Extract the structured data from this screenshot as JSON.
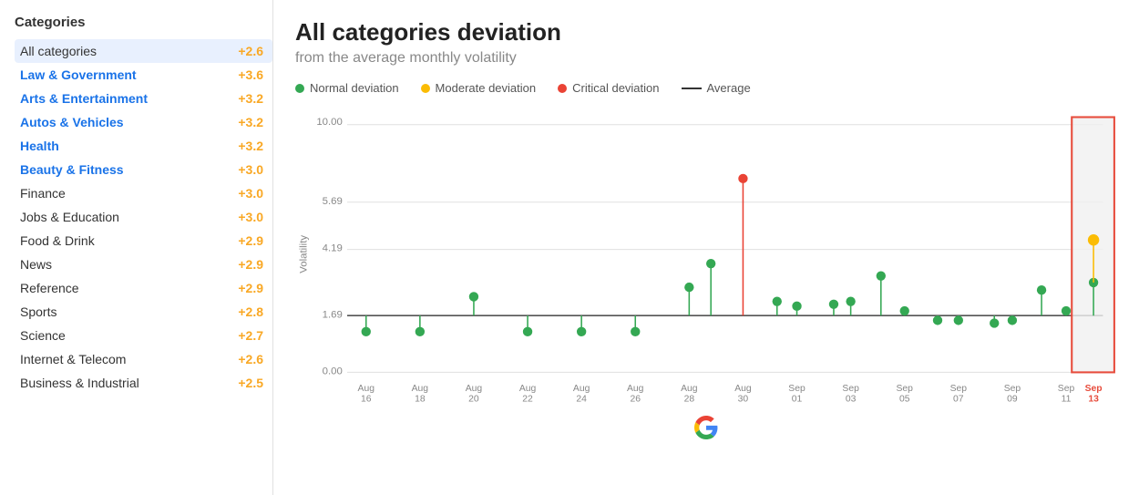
{
  "sidebar": {
    "title": "Categories",
    "items": [
      {
        "id": "all-categories",
        "name": "All categories",
        "value": "+2.6",
        "bold": false,
        "selected": true
      },
      {
        "id": "law-government",
        "name": "Law & Government",
        "value": "+3.6",
        "bold": true
      },
      {
        "id": "arts-entertainment",
        "name": "Arts & Entertainment",
        "value": "+3.2",
        "bold": true
      },
      {
        "id": "autos-vehicles",
        "name": "Autos & Vehicles",
        "value": "+3.2",
        "bold": true
      },
      {
        "id": "health",
        "name": "Health",
        "value": "+3.2",
        "bold": true
      },
      {
        "id": "beauty-fitness",
        "name": "Beauty & Fitness",
        "value": "+3.0",
        "bold": true
      },
      {
        "id": "finance",
        "name": "Finance",
        "value": "+3.0",
        "bold": false
      },
      {
        "id": "jobs-education",
        "name": "Jobs & Education",
        "value": "+3.0",
        "bold": false
      },
      {
        "id": "food-drink",
        "name": "Food & Drink",
        "value": "+2.9",
        "bold": false
      },
      {
        "id": "news",
        "name": "News",
        "value": "+2.9",
        "bold": false
      },
      {
        "id": "reference",
        "name": "Reference",
        "value": "+2.9",
        "bold": false
      },
      {
        "id": "sports",
        "name": "Sports",
        "value": "+2.8",
        "bold": false
      },
      {
        "id": "science",
        "name": "Science",
        "value": "+2.7",
        "bold": false
      },
      {
        "id": "internet-telecom",
        "name": "Internet & Telecom",
        "value": "+2.6",
        "bold": false
      },
      {
        "id": "business-industrial",
        "name": "Business & Industrial",
        "value": "+2.5",
        "bold": false
      }
    ]
  },
  "chart": {
    "title": "All categories deviation",
    "subtitle": "from the average monthly volatility",
    "legend": {
      "normal": "Normal deviation",
      "moderate": "Moderate deviation",
      "critical": "Critical deviation",
      "average": "Average"
    },
    "y_labels": [
      "10.00",
      "5.69",
      "4.19",
      "1.69",
      "0.00"
    ],
    "x_labels": [
      "Aug 16",
      "Aug 18",
      "Aug 20",
      "Aug 22",
      "Aug 24",
      "Aug 26",
      "Aug 28",
      "Aug 30",
      "Sep 01",
      "Sep 03",
      "Sep 05",
      "Sep 07",
      "Sep 09",
      "Sep 11",
      "Sep 13"
    ],
    "average_line": 1.69
  }
}
